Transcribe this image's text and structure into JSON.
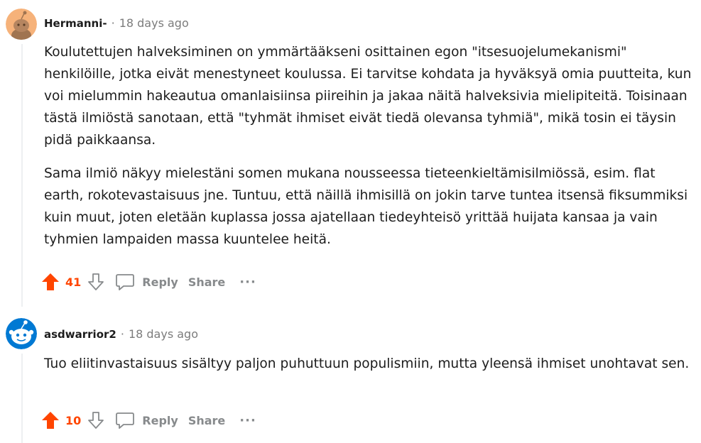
{
  "comments": [
    {
      "author": "Hermanni-",
      "separator": "·",
      "time": "18 days ago",
      "paragraphs": [
        "Koulutettujen halveksiminen on ymmärtääkseni osittainen egon \"itsesuojelumekanismi\" henkilöille, jotka eivät menestyneet koulussa. Ei tarvitse kohdata ja hyväksyä omia puutteita, kun voi mielummin hakeautua omanlaisiinsa piireihin ja jakaa näitä halveksivia mielipiteitä. Toisinaan tästä ilmiöstä sanotaan, että \"tyhmät ihmiset eivät tiedä olevansa tyhmiä\", mikä tosin ei täysin pidä paikkaansa.",
        "Sama ilmiö näkyy mielestäni somen mukana nousseessa tieteenkieltämisilmiössä, esim. flat earth, rokotevastaisuus jne. Tuntuu, että näillä ihmisillä on jokin tarve tuntea itsensä fiksummiksi kuin muut, joten eletään kuplassa jossa ajatellaan tiedeyhteisö yrittää huijata kansaa ja vain tyhmien lampaiden massa kuuntelee heitä."
      ],
      "score": "41",
      "reply_label": "Reply",
      "share_label": "Share",
      "more_label": "···"
    },
    {
      "author": "asdwarrior2",
      "separator": "·",
      "time": "18 days ago",
      "paragraphs": [
        "Tuo eliitinvastaisuus sisältyy paljon puhuttuun populismiin, mutta yleensä ihmiset unohtavat sen."
      ],
      "score": "10",
      "reply_label": "Reply",
      "share_label": "Share",
      "more_label": "···"
    }
  ],
  "colors": {
    "upvote": "#ff4500",
    "muted": "#878a8c",
    "thread_line": "#edeff1"
  }
}
